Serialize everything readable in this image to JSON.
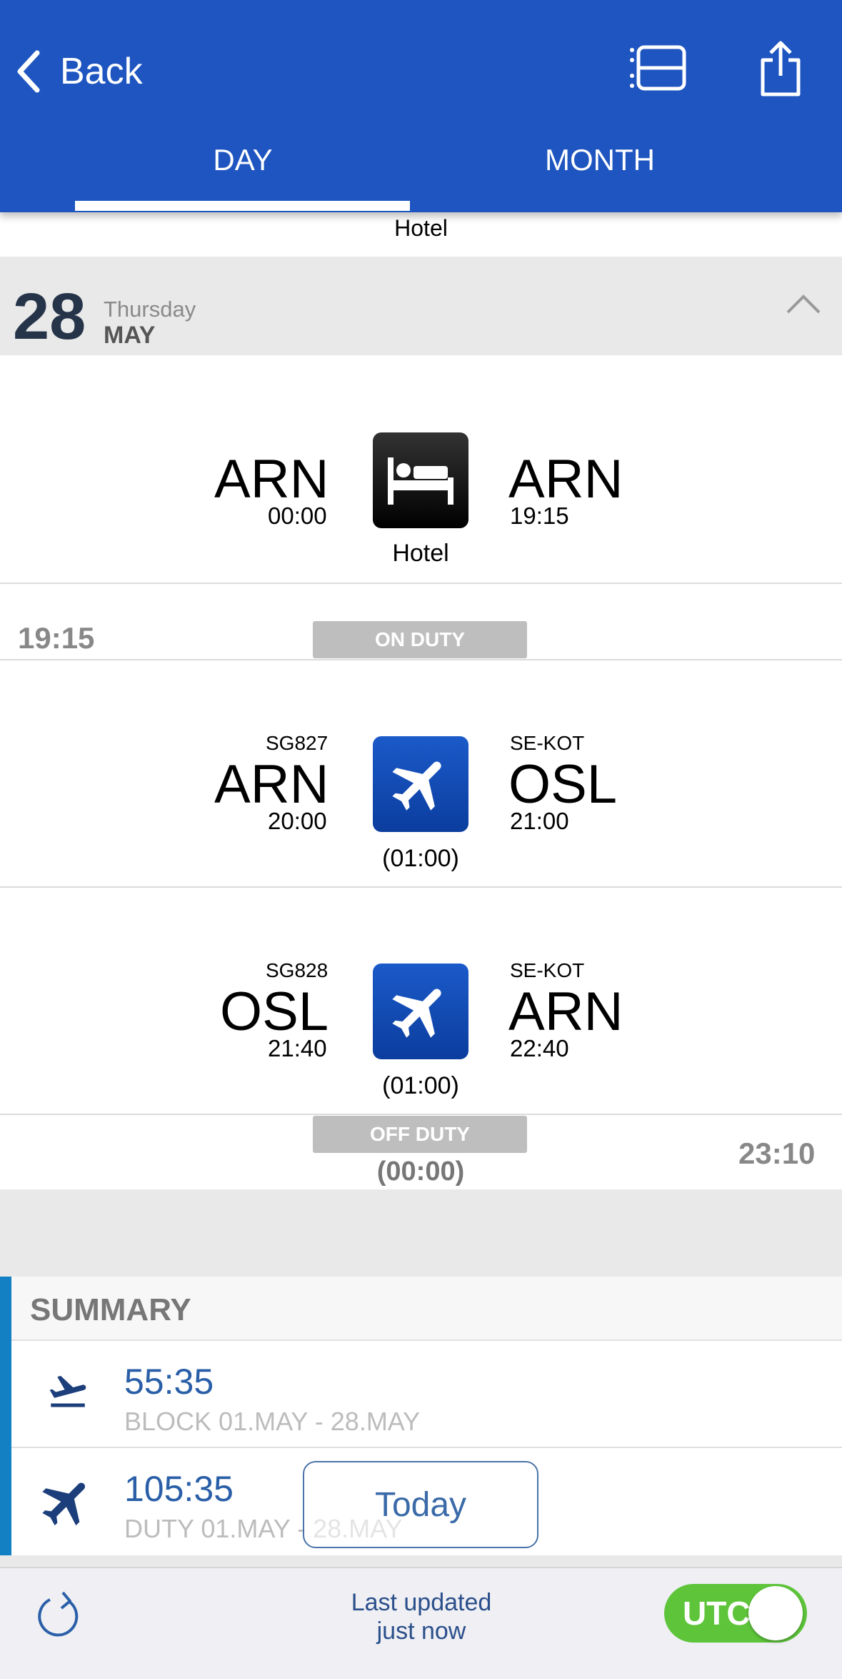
{
  "header": {
    "back_label": "Back",
    "tabs": [
      "DAY",
      "MONTH"
    ],
    "active_tab": "DAY",
    "color": "#1e55c0"
  },
  "top_card": {
    "label": "Hotel"
  },
  "day": {
    "number": "28",
    "weekday": "Thursday",
    "month": "MAY"
  },
  "hotel_card": {
    "from": "ARN",
    "from_time": "00:00",
    "to": "ARN",
    "to_time": "19:15",
    "label": "Hotel"
  },
  "on_duty": {
    "time": "19:15",
    "label": "ON DUTY"
  },
  "flights": [
    {
      "flight": "SG827",
      "from": "ARN",
      "dep": "20:00",
      "reg": "SE-KOT",
      "to": "OSL",
      "arr": "21:00",
      "duration": "(01:00)"
    },
    {
      "flight": "SG828",
      "from": "OSL",
      "dep": "21:40",
      "reg": "SE-KOT",
      "to": "ARN",
      "arr": "22:40",
      "duration": "(01:00)"
    }
  ],
  "off_duty": {
    "label": "OFF DUTY",
    "duration": "(00:00)",
    "time": "23:10"
  },
  "summary": {
    "title": "SUMMARY",
    "rows": [
      {
        "value": "55:35",
        "label": "BLOCK 01.MAY - 28.MAY",
        "icon": "airplane-icon"
      },
      {
        "value": "105:35",
        "label": "DUTY 01.MAY - 28.MAY",
        "icon": "airplane-icon"
      }
    ]
  },
  "today_button": "Today",
  "footer": {
    "updated_line1": "Last updated",
    "updated_line2": "just now",
    "utc_label": "UTC"
  }
}
